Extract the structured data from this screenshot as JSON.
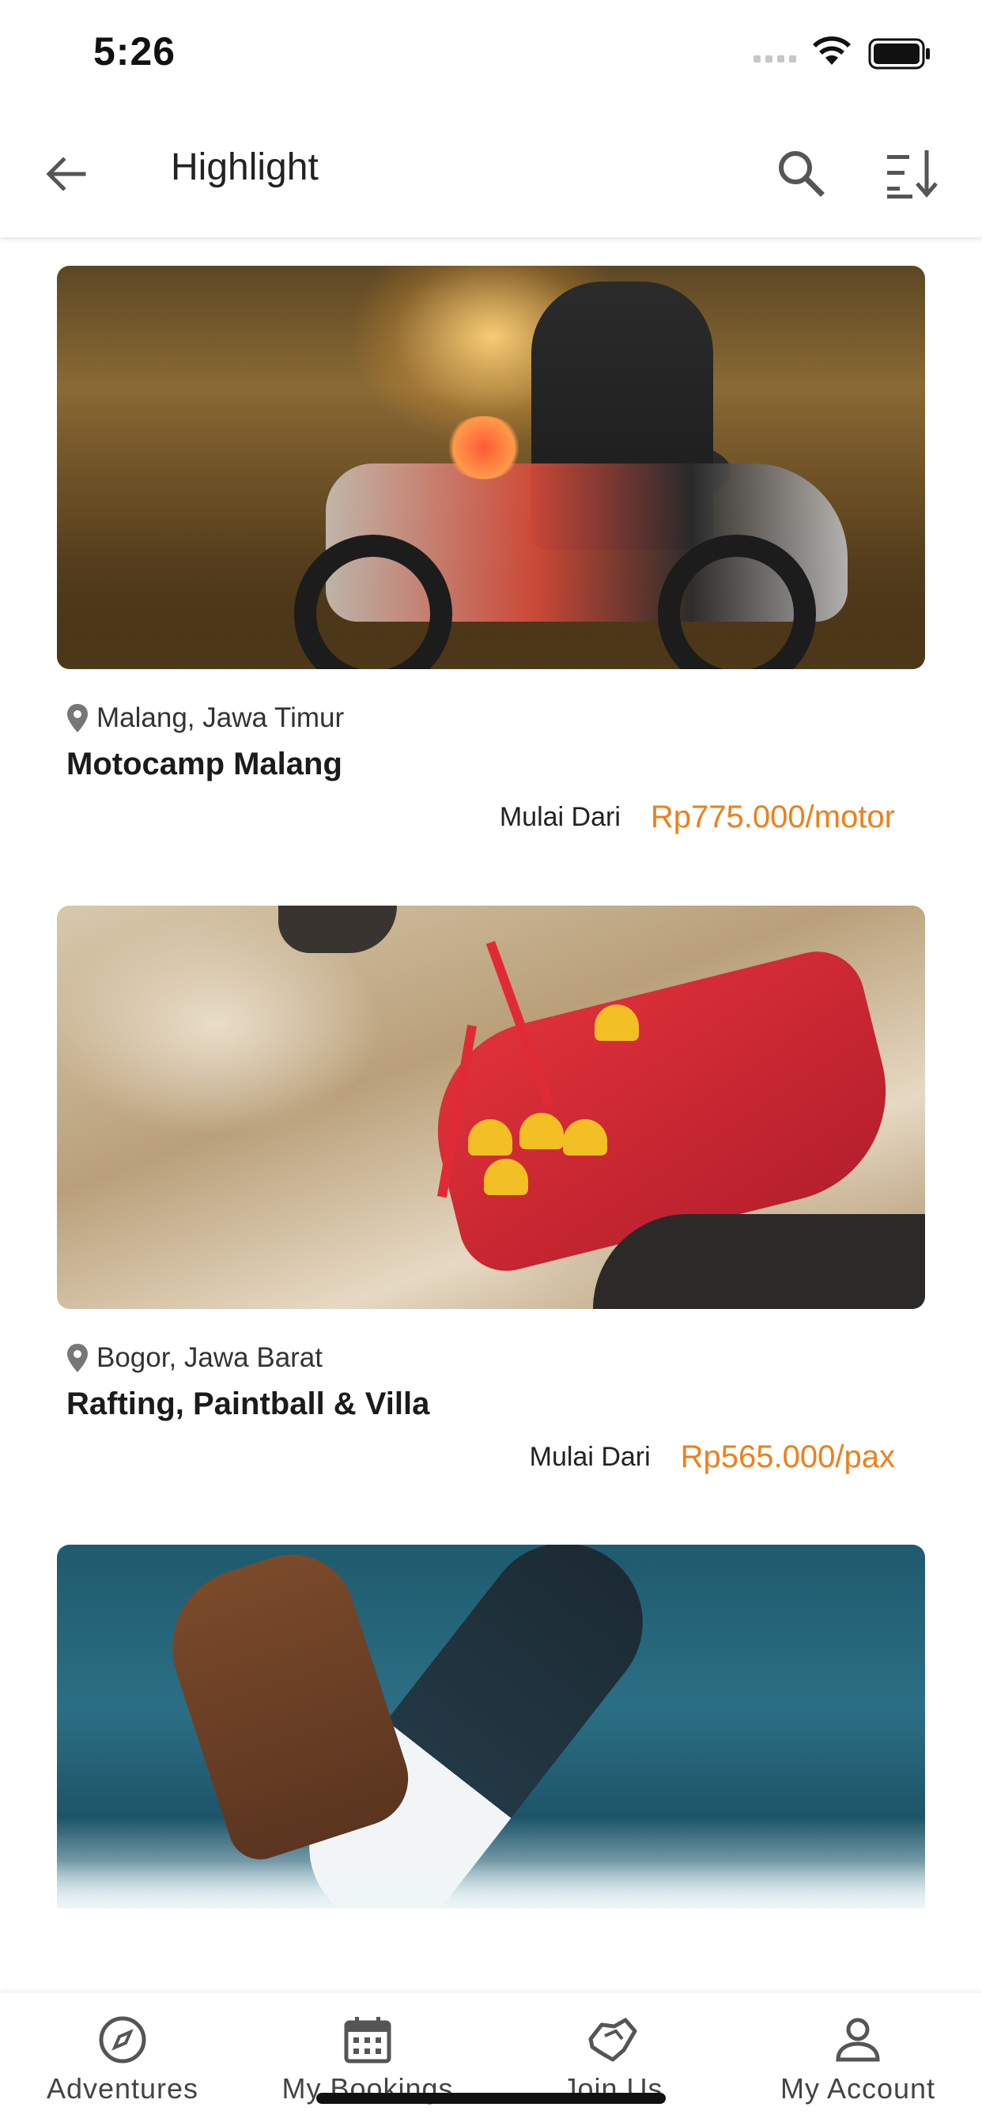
{
  "status_bar": {
    "time": "5:26"
  },
  "app_bar": {
    "title": "Highlight"
  },
  "cards": [
    {
      "location": "Malang, Jawa Timur",
      "name": "Motocamp Malang",
      "price_label": "Mulai Dari",
      "price": "Rp775.000/motor"
    },
    {
      "location": "Bogor, Jawa Barat",
      "name": "Rafting, Paintball & Villa",
      "price_label": "Mulai Dari",
      "price": "Rp565.000/pax"
    }
  ],
  "bottom_nav": {
    "items": [
      {
        "label": "Adventures",
        "icon": "compass-icon"
      },
      {
        "label": "My Bookings",
        "icon": "calendar-icon"
      },
      {
        "label": "Join Us",
        "icon": "handshake-icon"
      },
      {
        "label": "My Account",
        "icon": "person-icon"
      }
    ]
  },
  "colors": {
    "accent": "#ef7f1a",
    "icon": "#555555"
  }
}
